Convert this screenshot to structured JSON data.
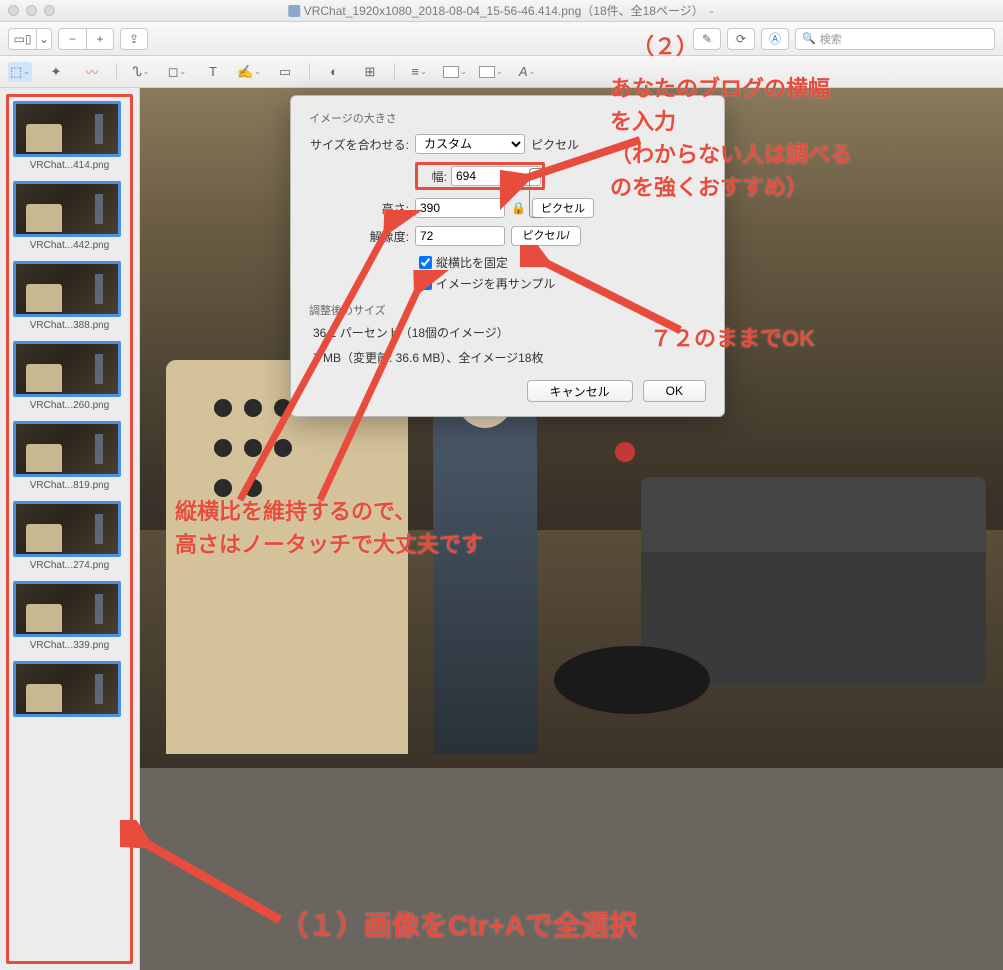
{
  "window": {
    "title": "VRChat_1920x1080_2018-08-04_15-56-46.414.png（18件、全18ページ）"
  },
  "search": {
    "placeholder": "検索"
  },
  "thumbnails": [
    {
      "label": "VRChat...414.png"
    },
    {
      "label": "VRChat...442.png"
    },
    {
      "label": "VRChat...388.png"
    },
    {
      "label": "VRChat...260.png"
    },
    {
      "label": "VRChat...819.png"
    },
    {
      "label": "VRChat...274.png"
    },
    {
      "label": "VRChat...339.png"
    },
    {
      "label": ""
    }
  ],
  "dialog": {
    "section1": "イメージの大きさ",
    "fit_label": "サイズを合わせる:",
    "fit_value": "カスタム",
    "fit_unit": "ピクセル",
    "width_label": "幅:",
    "width_value": "694",
    "height_label": "高さ:",
    "height_value": "390",
    "px_unit": "ピクセル",
    "res_label": "解像度:",
    "res_value": "72",
    "res_unit": "ピクセル/インチ",
    "lock_aspect": "縦横比を固定",
    "resample": "イメージを再サンプル",
    "section2": "調整後のサイズ",
    "percent_info": "36.1 パーセント（18個のイメージ）",
    "size_info": "7 MB（変更前: 36.6 MB）、全イメージ18枚",
    "cancel": "キャンセル",
    "ok": "OK"
  },
  "annotations": {
    "a2_num": "（２）",
    "a2_line1": "あなたのブログの横幅",
    "a2_line2": "を入力",
    "a2_line3": "（わからない人は調べる",
    "a2_line4": "のを強くおすすめ）",
    "a72": "７２のままでOK",
    "aspect1": "縦横比を維持するので、",
    "aspect2": "高さはノータッチで大丈夫です",
    "a1": "（１）画像をCtr+Aで全選択"
  },
  "colors": {
    "accent": "#e84c3d"
  }
}
